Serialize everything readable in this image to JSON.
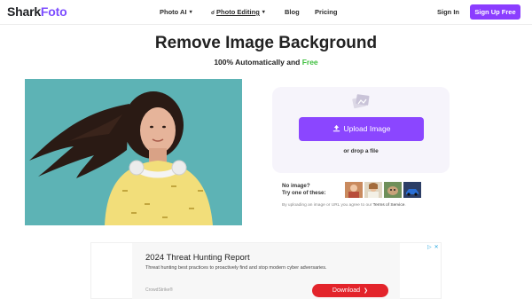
{
  "header": {
    "logo_shark": "Shark",
    "logo_foto": "Foto",
    "nav": {
      "photo_ai": "Photo AI",
      "photo_editing": "Photo Editing",
      "blog": "Blog",
      "pricing": "Pricing"
    },
    "sign_in": "Sign In",
    "sign_up": "Sign Up Free"
  },
  "main": {
    "title": "Remove Image Background",
    "subtitle_prefix": "100% Automatically and",
    "subtitle_free": "Free",
    "upload_button": "Upload Image",
    "drop_text": "or drop a file",
    "no_image_line1": "No image?",
    "no_image_line2": "Try one of these:",
    "terms_prefix": "By uploading an image or URL you agree to our",
    "terms_link": "Terms of Service",
    "terms_suffix": "."
  },
  "ad": {
    "title": "2024 Threat Hunting Report",
    "description": "Threat hunting best practices to proactively find and stop modern cyber adversaries.",
    "brand": "CrowdStrike®",
    "button": "Download"
  },
  "colors": {
    "accent": "#8b3dff",
    "free_green": "#3fbf3f",
    "hero_bg": "#5db3b5",
    "ad_button": "#e3242b"
  },
  "icons": {
    "nav_caret": "chevron-down-icon",
    "nav_search": "search-icon",
    "upload": "upload-icon",
    "panel_image": "image-icon",
    "ad_choices": "adchoices-icon",
    "ad_close": "close-icon"
  }
}
